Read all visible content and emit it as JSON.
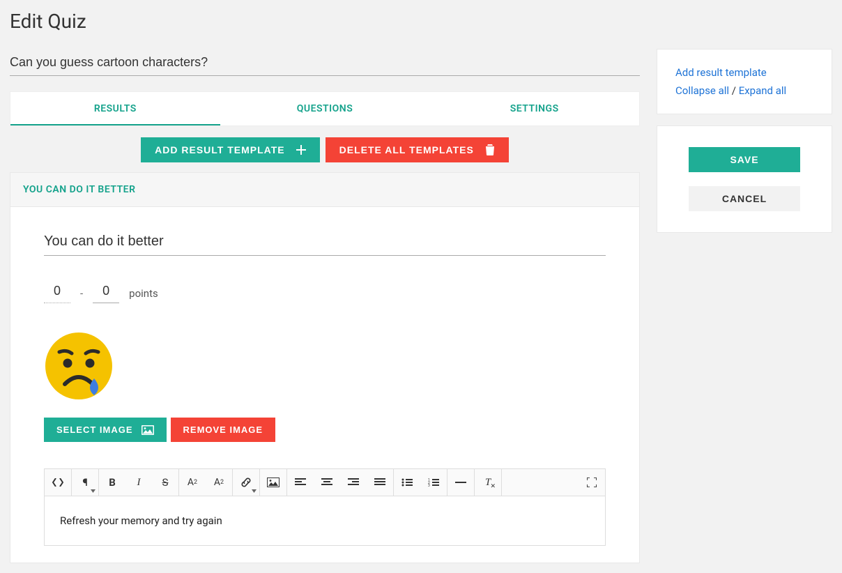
{
  "page": {
    "title": "Edit Quiz"
  },
  "quiz": {
    "name": "Can you guess cartoon characters?"
  },
  "tabs": {
    "results": "RESULTS",
    "questions": "QUESTIONS",
    "settings": "SETTINGS",
    "active": "results"
  },
  "actions": {
    "add_template": "ADD RESULT TEMPLATE",
    "delete_all": "DELETE ALL TEMPLATES",
    "select_image": "SELECT IMAGE",
    "remove_image": "REMOVE IMAGE",
    "save": "SAVE",
    "cancel": "CANCEL"
  },
  "result": {
    "header": "YOU CAN DO IT BETTER",
    "title": "You can do it better",
    "points": {
      "from": "0",
      "to": "0",
      "label": "points"
    },
    "image": {
      "name": "sad-face-emoji"
    },
    "content": "Refresh your memory and try again"
  },
  "side": {
    "add_link": "Add result template",
    "collapse": "Collapse all",
    "sep": " / ",
    "expand": "Expand all"
  },
  "toolbar": {
    "code": "code-view-icon",
    "para": "paragraph-format-icon",
    "bold": "B",
    "italic": "I",
    "strike": "S",
    "sup": "superscript-icon",
    "sub": "subscript-icon",
    "link": "link-icon",
    "image": "insert-image-icon",
    "al": "align-left-icon",
    "ac": "align-center-icon",
    "ar": "align-right-icon",
    "aj": "align-justify-icon",
    "ul": "unordered-list-icon",
    "ol": "ordered-list-icon",
    "hr": "horizontal-rule-icon",
    "clear": "clear-format-icon",
    "full": "fullscreen-icon"
  }
}
